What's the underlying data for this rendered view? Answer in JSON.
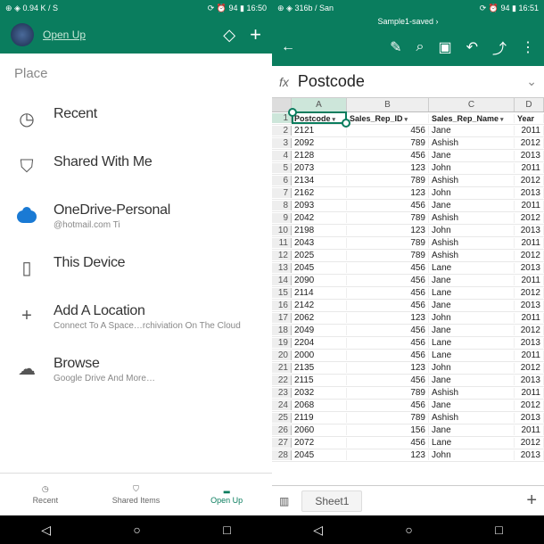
{
  "left": {
    "status_left": "⊕ ◈ 0.94 K / S",
    "status_right": "⟳ ⏰ 94 ▮ 16:50",
    "open_up": "Open Up",
    "place": "Place",
    "items": [
      {
        "label": "Recent",
        "sub": ""
      },
      {
        "label": "Shared With Me",
        "sub": ""
      },
      {
        "label": "OneDrive-Personal",
        "sub": "@hotmail.com Ti"
      },
      {
        "label": "This Device",
        "sub": ""
      },
      {
        "label": "Add A Location",
        "sub": "Connect To A Space…rchiviation On The Cloud"
      },
      {
        "label": "Browse",
        "sub": "Google Drive And More…"
      }
    ],
    "tabs": [
      {
        "label": "Recent"
      },
      {
        "label": "Shared Items"
      },
      {
        "label": "Open Up"
      }
    ]
  },
  "right": {
    "status_left": "⊕ ◈ 316b / San",
    "status_right": "⟳ ⏰ 94 ▮ 16:51",
    "title": "Sample1-saved ›",
    "fx_label": "fx",
    "fx_value": "Postcode",
    "cols": [
      "",
      "A",
      "B",
      "C",
      "D"
    ],
    "headers": [
      "Postcode",
      "Sales_Rep_ID",
      "Sales_Rep_Name",
      "Year"
    ],
    "rows": [
      [
        "2",
        "2121",
        "456",
        "Jane",
        "2011"
      ],
      [
        "3",
        "2092",
        "789",
        "Ashish",
        "2012"
      ],
      [
        "4",
        "2128",
        "456",
        "Jane",
        "2013"
      ],
      [
        "5",
        "2073",
        "123",
        "John",
        "2011"
      ],
      [
        "6",
        "2134",
        "789",
        "Ashish",
        "2012"
      ],
      [
        "7",
        "2162",
        "123",
        "John",
        "2013"
      ],
      [
        "8",
        "2093",
        "456",
        "Jane",
        "2011"
      ],
      [
        "9",
        "2042",
        "789",
        "Ashish",
        "2012"
      ],
      [
        "10",
        "2198",
        "123",
        "John",
        "2013"
      ],
      [
        "11",
        "2043",
        "789",
        "Ashish",
        "2011"
      ],
      [
        "12",
        "2025",
        "789",
        "Ashish",
        "2012"
      ],
      [
        "13",
        "2045",
        "456",
        "Lane",
        "2013"
      ],
      [
        "14",
        "2090",
        "456",
        "Jane",
        "2011"
      ],
      [
        "15",
        "2114",
        "456",
        "Lane",
        "2012"
      ],
      [
        "16",
        "2142",
        "456",
        "Jane",
        "2013"
      ],
      [
        "17",
        "2062",
        "123",
        "John",
        "2011"
      ],
      [
        "18",
        "2049",
        "456",
        "Jane",
        "2012"
      ],
      [
        "19",
        "2204",
        "456",
        "Lane",
        "2013"
      ],
      [
        "20",
        "2000",
        "456",
        "Lane",
        "2011"
      ],
      [
        "21",
        "2135",
        "123",
        "John",
        "2012"
      ],
      [
        "22",
        "2115",
        "456",
        "Jane",
        "2013"
      ],
      [
        "23",
        "2032",
        "789",
        "Ashish",
        "2011"
      ],
      [
        "24",
        "2068",
        "456",
        "Jane",
        "2012"
      ],
      [
        "25",
        "2119",
        "789",
        "Ashish",
        "2013"
      ],
      [
        "26",
        "2060",
        "156",
        "Jane",
        "2011"
      ],
      [
        "27",
        "2072",
        "456",
        "Lane",
        "2012"
      ],
      [
        "28",
        "2045",
        "123",
        "John",
        "2013"
      ]
    ],
    "sheet_tab": "Sheet1"
  }
}
